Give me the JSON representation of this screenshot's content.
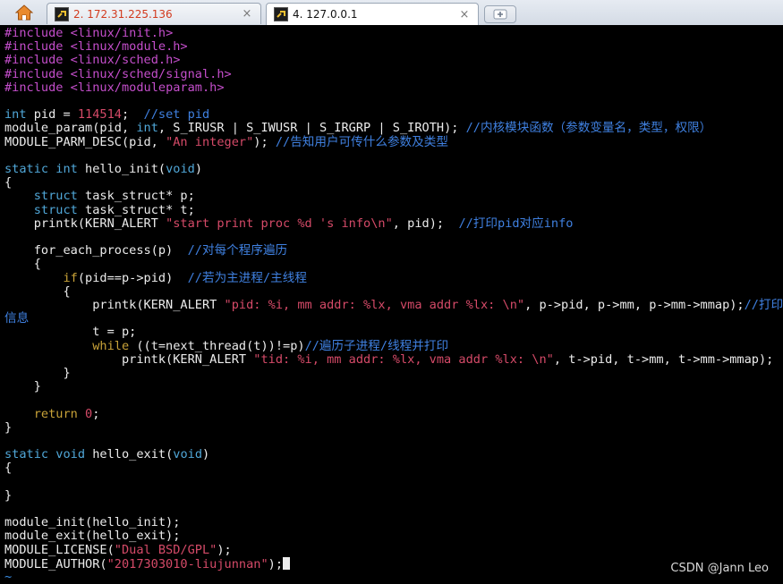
{
  "tabs": [
    {
      "title": "2. 172.31.225.136",
      "active": false
    },
    {
      "title": "4. 127.0.0.1",
      "active": true
    }
  ],
  "icons": {
    "home": "home-icon",
    "session": "terminal-icon",
    "close": "close-icon",
    "new_tab": "new-tab-icon"
  },
  "close_glyph": "×",
  "colors": {
    "background": "#000000",
    "text": "#ececec",
    "preprocessor": "#c44ecb",
    "type": "#50a7d8",
    "comment": "#3f80e0",
    "string": "#d54a68",
    "keyword": "#c8a238"
  },
  "code_lines": [
    [
      [
        "#include ",
        "m"
      ],
      [
        "<linux/init.h>",
        "m"
      ]
    ],
    [
      [
        "#include ",
        "m"
      ],
      [
        "<linux/module.h>",
        "m"
      ]
    ],
    [
      [
        "#include ",
        "m"
      ],
      [
        "<linux/sched.h>",
        "m"
      ]
    ],
    [
      [
        "#include ",
        "m"
      ],
      [
        "<linux/sched/signal.h>",
        "m"
      ]
    ],
    [
      [
        "#include ",
        "m"
      ],
      [
        "<linux/moduleparam.h>",
        "m"
      ]
    ],
    [],
    [
      [
        "int",
        "g"
      ],
      [
        " pid = ",
        "w"
      ],
      [
        "114514",
        "r"
      ],
      [
        ";  ",
        "w"
      ],
      [
        "//set pid",
        "b"
      ]
    ],
    [
      [
        "module_param(pid, ",
        "w"
      ],
      [
        "int",
        "g"
      ],
      [
        ", S_IRUSR | S_IWUSR | S_IRGRP | S_IROTH); ",
        "w"
      ],
      [
        "//内核模块函数（参数变量名，类型，权限）",
        "b"
      ]
    ],
    [
      [
        "MODULE_PARM_DESC(pid, ",
        "w"
      ],
      [
        "\"An integer\"",
        "r"
      ],
      [
        "); ",
        "w"
      ],
      [
        "//告知用户可传什么参数及类型",
        "b"
      ]
    ],
    [],
    [
      [
        "static",
        "g"
      ],
      [
        " ",
        "w"
      ],
      [
        "int",
        "g"
      ],
      [
        " hello_init(",
        "w"
      ],
      [
        "void",
        "g"
      ],
      [
        ")",
        "w"
      ]
    ],
    [
      [
        "{",
        "w"
      ]
    ],
    [
      [
        "    ",
        "w"
      ],
      [
        "struct",
        "g"
      ],
      [
        " task_struct* p;",
        "w"
      ]
    ],
    [
      [
        "    ",
        "w"
      ],
      [
        "struct",
        "g"
      ],
      [
        " task_struct* t;",
        "w"
      ]
    ],
    [
      [
        "    printk(KERN_ALERT ",
        "w"
      ],
      [
        "\"start print proc %d 's info\\n\"",
        "r"
      ],
      [
        ", pid);  ",
        "w"
      ],
      [
        "//打印pid对应info",
        "b"
      ]
    ],
    [],
    [
      [
        "    for_each_process(p)  ",
        "w"
      ],
      [
        "//对每个程序遍历",
        "b"
      ]
    ],
    [
      [
        "    {",
        "w"
      ]
    ],
    [
      [
        "        ",
        "w"
      ],
      [
        "if",
        "y"
      ],
      [
        "(pid==p->pid)  ",
        "w"
      ],
      [
        "//若为主进程/主线程",
        "b"
      ]
    ],
    [
      [
        "        {",
        "w"
      ]
    ],
    [
      [
        "            printk(KERN_ALERT ",
        "w"
      ],
      [
        "\"pid: %i, mm addr: %lx, vma addr %lx: \\n\"",
        "r"
      ],
      [
        ", p->pid, p->mm, p->mm->mmap);",
        "w"
      ],
      [
        "//打印",
        "b"
      ]
    ],
    [
      [
        "信息",
        "b"
      ]
    ],
    [
      [
        "            t = p;",
        "w"
      ]
    ],
    [
      [
        "            ",
        "w"
      ],
      [
        "while",
        "y"
      ],
      [
        " ((t=next_thread(t))!=p)",
        "w"
      ],
      [
        "//遍历子进程/线程并打印",
        "b"
      ]
    ],
    [
      [
        "                printk(KERN_ALERT ",
        "w"
      ],
      [
        "\"tid: %i, mm addr: %lx, vma addr %lx: \\n\"",
        "r"
      ],
      [
        ", t->pid, t->mm, t->mm->mmap);",
        "w"
      ]
    ],
    [
      [
        "        }",
        "w"
      ]
    ],
    [
      [
        "    }",
        "w"
      ]
    ],
    [],
    [
      [
        "    ",
        "w"
      ],
      [
        "return",
        "y"
      ],
      [
        " ",
        "w"
      ],
      [
        "0",
        "r"
      ],
      [
        ";",
        "w"
      ]
    ],
    [
      [
        "}",
        "w"
      ]
    ],
    [],
    [
      [
        "static",
        "g"
      ],
      [
        " ",
        "w"
      ],
      [
        "void",
        "g"
      ],
      [
        " hello_exit(",
        "w"
      ],
      [
        "void",
        "g"
      ],
      [
        ")",
        "w"
      ]
    ],
    [
      [
        "{",
        "w"
      ]
    ],
    [],
    [
      [
        "}",
        "w"
      ]
    ],
    [],
    [
      [
        "module_init(hello_init);",
        "w"
      ]
    ],
    [
      [
        "module_exit(hello_exit);",
        "w"
      ]
    ],
    [
      [
        "MODULE_LICENSE(",
        "w"
      ],
      [
        "\"Dual BSD/GPL\"",
        "r"
      ],
      [
        ");",
        "w"
      ]
    ],
    [
      [
        "MODULE_AUTHOR(",
        "w"
      ],
      [
        "\"2017303010-liujunnan\"",
        "r"
      ],
      [
        ");",
        "w"
      ]
    ],
    [
      [
        "~",
        "tilde"
      ]
    ]
  ],
  "watermark": "CSDN @Jann Leo"
}
